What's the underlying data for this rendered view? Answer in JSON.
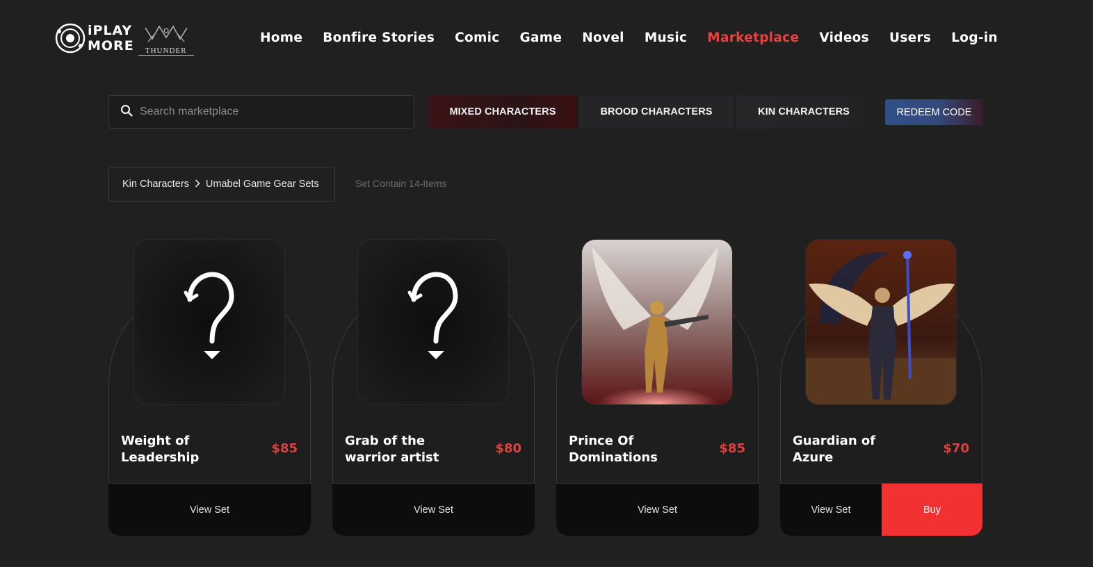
{
  "brand": {
    "line1": "iPLAY",
    "line2": "MORE",
    "partner": "THUNDER"
  },
  "nav": {
    "items": [
      {
        "label": "Home"
      },
      {
        "label": "Bonfire Stories"
      },
      {
        "label": "Comic"
      },
      {
        "label": "Game"
      },
      {
        "label": "Novel"
      },
      {
        "label": "Music"
      },
      {
        "label": "Marketplace",
        "active": true
      },
      {
        "label": "Videos"
      },
      {
        "label": "Users"
      },
      {
        "label": "Log-in"
      }
    ]
  },
  "search": {
    "placeholder": "Search marketplace",
    "icon": "search-icon"
  },
  "tabs": [
    {
      "label": "MIXED CHARACTERS",
      "active": true
    },
    {
      "label": "BROOD CHARACTERS"
    },
    {
      "label": "KIN CHARACTERS"
    }
  ],
  "redeem_label": "REDEEM CODE",
  "breadcrumb": {
    "parent": "Kin Characters",
    "current": "Umabel Game Gear Sets"
  },
  "set_info": "Set Contain 14-Items",
  "colors": {
    "accent": "#f0403e",
    "price": "#e0403d",
    "buy": "#f23132",
    "background": "#202021"
  },
  "cards": [
    {
      "title": "Weight of Leadership",
      "price": "$85",
      "image": "mystery-question-icon",
      "view_label": "View Set"
    },
    {
      "title": "Grab of the warrior artist",
      "price": "$80",
      "image": "mystery-question-icon",
      "view_label": "View Set"
    },
    {
      "title": "Prince Of Dominations",
      "price": "$85",
      "image": "winged-golden-knight-render",
      "view_label": "View Set"
    },
    {
      "title": "Guardian of Azure",
      "price": "$70",
      "image": "winged-azure-guardian-render",
      "view_label": "View Set",
      "buy_label": "Buy"
    }
  ]
}
